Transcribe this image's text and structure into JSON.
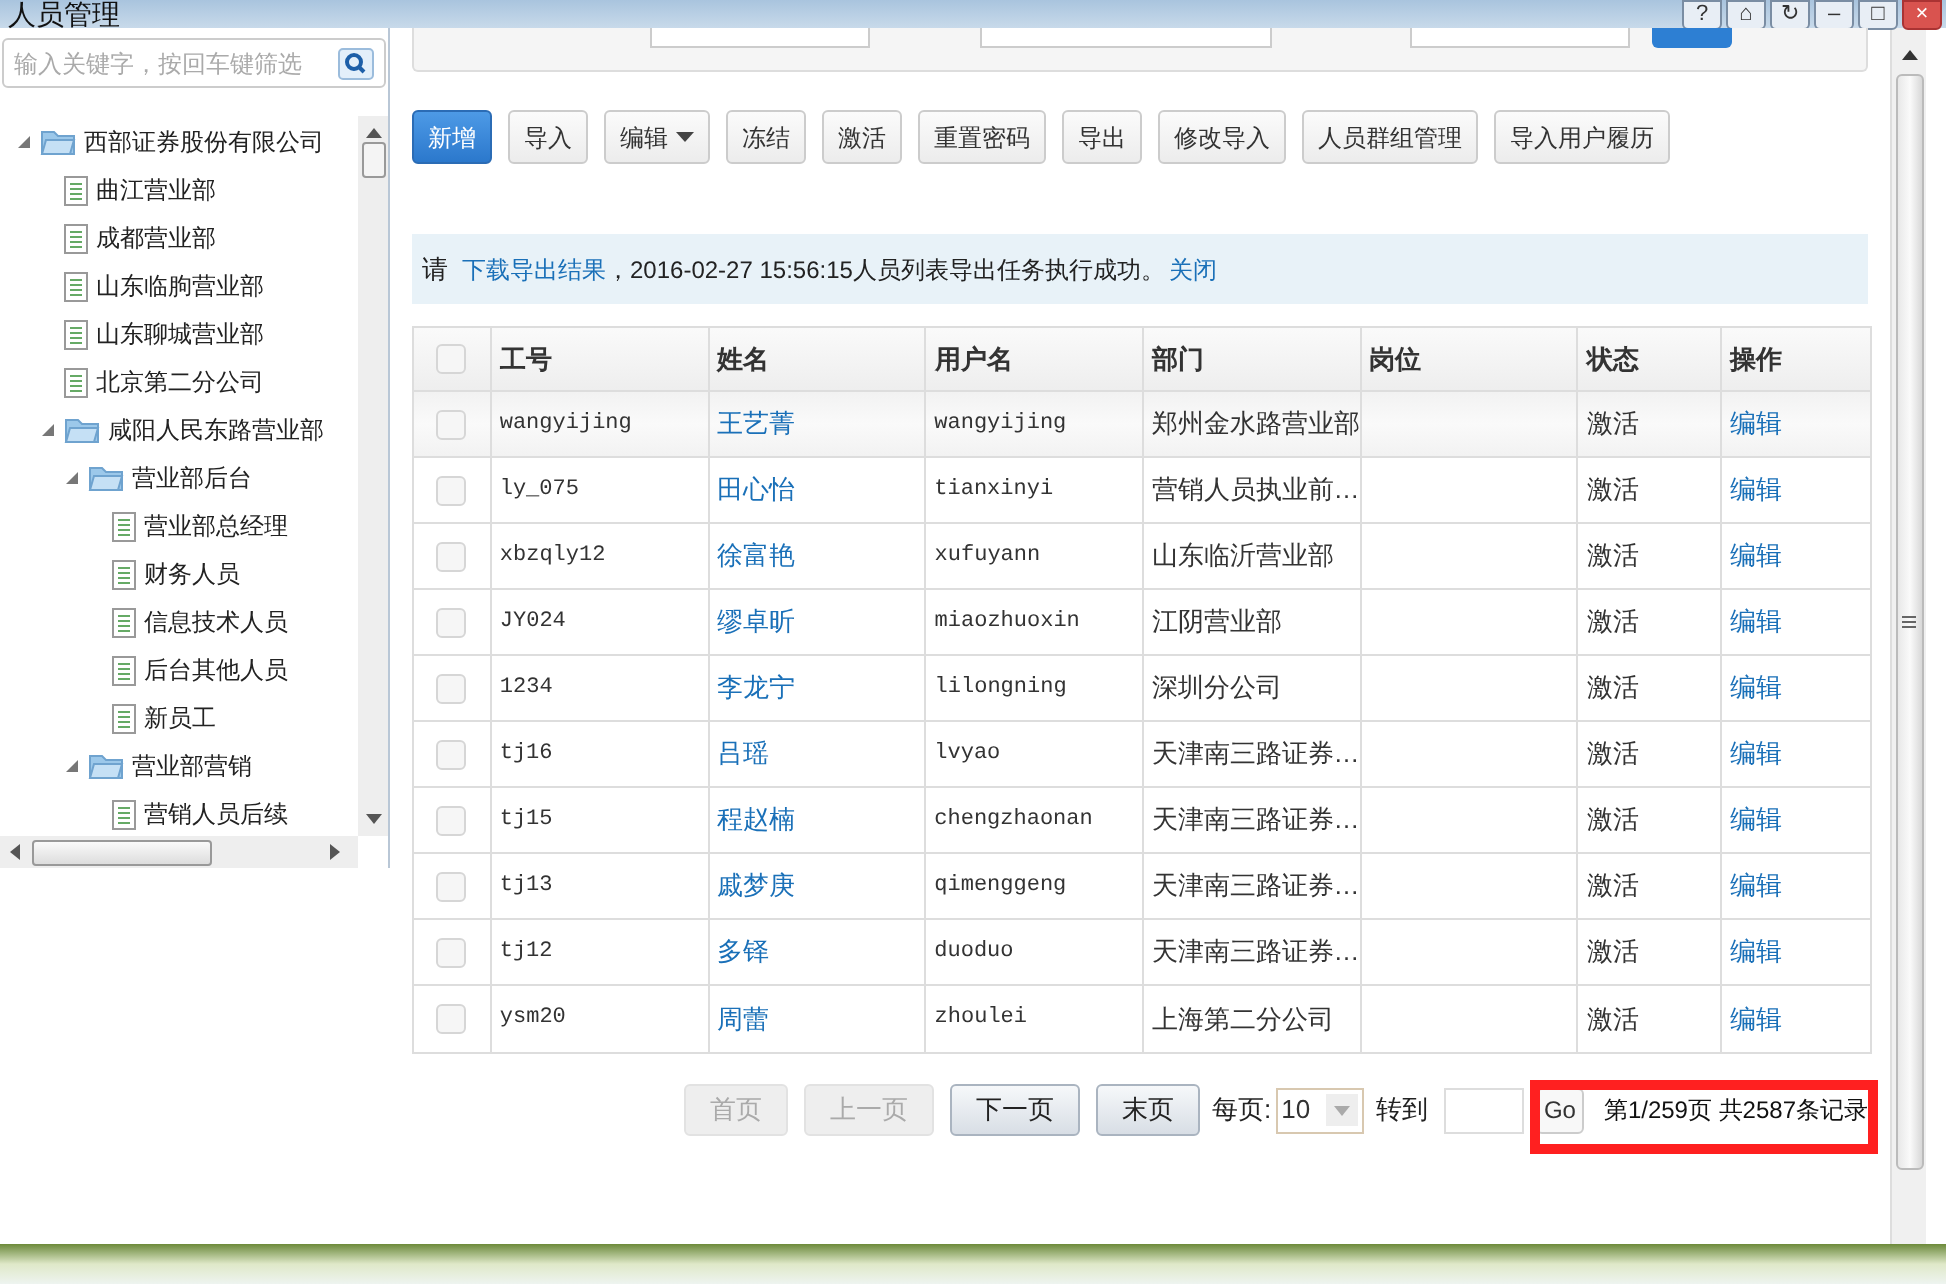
{
  "window": {
    "title": "人员管理",
    "buttons": [
      "?",
      "⌂",
      "↻",
      "–",
      "□",
      "×"
    ]
  },
  "sidebar": {
    "search": {
      "placeholder": "输入关键字，按回车键筛选"
    },
    "tree": [
      {
        "label": "西部证券股份有限公司",
        "kind": "folder",
        "expanded": true,
        "children": [
          {
            "label": "曲江营业部",
            "kind": "file"
          },
          {
            "label": "成都营业部",
            "kind": "file"
          },
          {
            "label": "山东临朐营业部",
            "kind": "file"
          },
          {
            "label": "山东聊城营业部",
            "kind": "file"
          },
          {
            "label": "北京第二分公司",
            "kind": "file"
          },
          {
            "label": "咸阳人民东路营业部",
            "kind": "folder",
            "expanded": true,
            "children": [
              {
                "label": "营业部后台",
                "kind": "folder",
                "expanded": true,
                "children": [
                  {
                    "label": "营业部总经理",
                    "kind": "file"
                  },
                  {
                    "label": "财务人员",
                    "kind": "file"
                  },
                  {
                    "label": "信息技术人员",
                    "kind": "file"
                  },
                  {
                    "label": "后台其他人员",
                    "kind": "file"
                  },
                  {
                    "label": "新员工",
                    "kind": "file"
                  }
                ]
              },
              {
                "label": "营业部营销",
                "kind": "folder",
                "expanded": true,
                "children": [
                  {
                    "label": "营销人员后续",
                    "kind": "file"
                  }
                ]
              }
            ]
          }
        ]
      }
    ]
  },
  "toolbar": [
    {
      "label": "新增",
      "primary": true,
      "dropdown": false
    },
    {
      "label": "导入",
      "primary": false,
      "dropdown": false
    },
    {
      "label": "编辑",
      "primary": false,
      "dropdown": true
    },
    {
      "label": "冻结",
      "primary": false,
      "dropdown": false
    },
    {
      "label": "激活",
      "primary": false,
      "dropdown": false
    },
    {
      "label": "重置密码",
      "primary": false,
      "dropdown": false
    },
    {
      "label": "导出",
      "primary": false,
      "dropdown": false
    },
    {
      "label": "修改导入",
      "primary": false,
      "dropdown": false
    },
    {
      "label": "人员群组管理",
      "primary": false,
      "dropdown": false
    },
    {
      "label": "导入用户履历",
      "primary": false,
      "dropdown": false
    }
  ],
  "notice": {
    "prefix": "请",
    "link": "下载导出结果",
    "message": "，2016-02-27 15:56:15人员列表导出任务执行成功。",
    "close": "关闭"
  },
  "table": {
    "all_checked": false,
    "columns": [
      "工号",
      "姓名",
      "用户名",
      "部门",
      "岗位",
      "状态",
      "操作"
    ],
    "rows": [
      {
        "id": "wangyijing",
        "name": "王艺菁",
        "username": "wangyijing",
        "dept": "郑州金水路营业部",
        "status": "激活",
        "action": "编辑",
        "checked": false,
        "hovered": true
      },
      {
        "id": "ly_075",
        "name": "田心怡",
        "username": "tianxinyi",
        "dept": "营销人员执业前…",
        "status": "激活",
        "action": "编辑",
        "checked": false,
        "hovered": false
      },
      {
        "id": "xbzqly12",
        "name": "徐富艳",
        "username": "xufuyann",
        "dept": "山东临沂营业部",
        "status": "激活",
        "action": "编辑",
        "checked": false,
        "hovered": false
      },
      {
        "id": "JY024",
        "name": "缪卓昕",
        "username": "miaozhuoxin",
        "dept": "江阴营业部",
        "status": "激活",
        "action": "编辑",
        "checked": false,
        "hovered": false
      },
      {
        "id": "1234",
        "name": "李龙宁",
        "username": "lilongning",
        "dept": "深圳分公司",
        "status": "激活",
        "action": "编辑",
        "checked": false,
        "hovered": false
      },
      {
        "id": "tj16",
        "name": "吕瑶",
        "username": "lvyao",
        "dept": "天津南三路证券…",
        "status": "激活",
        "action": "编辑",
        "checked": false,
        "hovered": false
      },
      {
        "id": "tj15",
        "name": "程赵楠",
        "username": "chengzhaonan",
        "dept": "天津南三路证券…",
        "status": "激活",
        "action": "编辑",
        "checked": false,
        "hovered": false
      },
      {
        "id": "tj13",
        "name": "戚梦庚",
        "username": "qimenggeng",
        "dept": "天津南三路证券…",
        "status": "激活",
        "action": "编辑",
        "checked": false,
        "hovered": false
      },
      {
        "id": "tj12",
        "name": "多铎",
        "username": "duoduo",
        "dept": "天津南三路证券…",
        "status": "激活",
        "action": "编辑",
        "checked": false,
        "hovered": false
      },
      {
        "id": "ysm20",
        "name": "周蕾",
        "username": "zhoulei",
        "dept": "上海第二分公司",
        "status": "激活",
        "action": "编辑",
        "checked": false,
        "hovered": false
      }
    ]
  },
  "pagination": {
    "buttons": [
      {
        "label": "首页",
        "disabled": true
      },
      {
        "label": "上一页",
        "disabled": true
      },
      {
        "label": "下一页",
        "disabled": false
      },
      {
        "label": "末页",
        "disabled": false
      }
    ],
    "per_page_label": "每页:",
    "per_page": "10",
    "goto_label": "转到",
    "go": "Go",
    "summary": "第1/259页 共2587条记录"
  }
}
